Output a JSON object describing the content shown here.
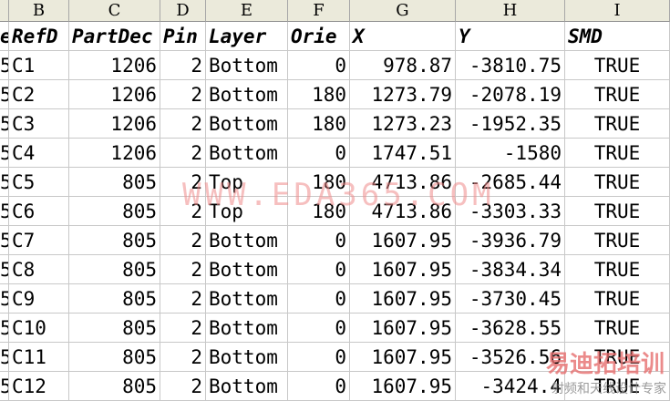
{
  "column_letters": [
    "B",
    "C",
    "D",
    "E",
    "F",
    "G",
    "H",
    "I"
  ],
  "partial_first_col": "e",
  "partial_first_col_rows": "5",
  "header_row": [
    "RefD",
    "PartDec",
    "Pin",
    "Layer",
    "Orie",
    "X",
    "Y",
    "SMD"
  ],
  "rows": [
    [
      "C1",
      "1206",
      "2",
      "Bottom",
      "0",
      "978.87",
      "-3810.75",
      "TRUE"
    ],
    [
      "C2",
      "1206",
      "2",
      "Bottom",
      "180",
      "1273.79",
      "-2078.19",
      "TRUE"
    ],
    [
      "C3",
      "1206",
      "2",
      "Bottom",
      "180",
      "1273.23",
      "-1952.35",
      "TRUE"
    ],
    [
      "C4",
      "1206",
      "2",
      "Bottom",
      "0",
      "1747.51",
      "-1580",
      "TRUE"
    ],
    [
      "C5",
      "805",
      "2",
      "Top",
      "180",
      "4713.86",
      "-2685.44",
      "TRUE"
    ],
    [
      "C6",
      "805",
      "2",
      "Top",
      "180",
      "4713.86",
      "-3303.33",
      "TRUE"
    ],
    [
      "C7",
      "805",
      "2",
      "Bottom",
      "0",
      "1607.95",
      "-3936.79",
      "TRUE"
    ],
    [
      "C8",
      "805",
      "2",
      "Bottom",
      "0",
      "1607.95",
      "-3834.34",
      "TRUE"
    ],
    [
      "C9",
      "805",
      "2",
      "Bottom",
      "0",
      "1607.95",
      "-3730.45",
      "TRUE"
    ],
    [
      "C10",
      "805",
      "2",
      "Bottom",
      "0",
      "1607.95",
      "-3628.55",
      "TRUE"
    ],
    [
      "C11",
      "805",
      "2",
      "Bottom",
      "0",
      "1607.95",
      "-3526.56",
      "TRUE"
    ],
    [
      "C12",
      "805",
      "2",
      "Bottom",
      "0",
      "1607.95",
      "-3424.4",
      "TRUE"
    ]
  ],
  "watermark_text": "WWW.EDA365.COM",
  "logo_text": "易迪拓培训",
  "logo_subtext": "射频和天线设计专家"
}
